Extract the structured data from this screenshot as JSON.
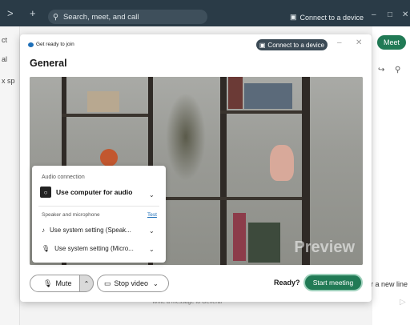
{
  "topbar": {
    "back": ">",
    "new": "+",
    "search_placeholder": "Search, meet, and call",
    "connect_label": "Connect to a device",
    "minimize": "–",
    "maximize": "□",
    "close": "✕"
  },
  "background": {
    "left_labels": [
      "ct",
      "al",
      "x sp"
    ],
    "meet_label": "Meet",
    "new_line_hint": "r a new line",
    "message_placeholder": "Write a message to General"
  },
  "dialog": {
    "window_title": "Get ready to join",
    "connect_label": "Connect to a device",
    "heading": "General",
    "preview_label": "Preview",
    "audio_panel": {
      "title": "Audio connection",
      "selected_option": "Use computer for audio",
      "speaker_mic_label": "Speaker and microphone",
      "test_label": "Test",
      "speaker_value": "Use system setting (Speak...",
      "microphone_value": "Use system setting (Micro..."
    },
    "mute_label": "Mute",
    "stop_video_label": "Stop video",
    "ready_label": "Ready?",
    "start_label": "Start meeting"
  },
  "colors": {
    "accent": "#217a55",
    "topbar": "#2a3b47",
    "link": "#1e6fb8"
  }
}
